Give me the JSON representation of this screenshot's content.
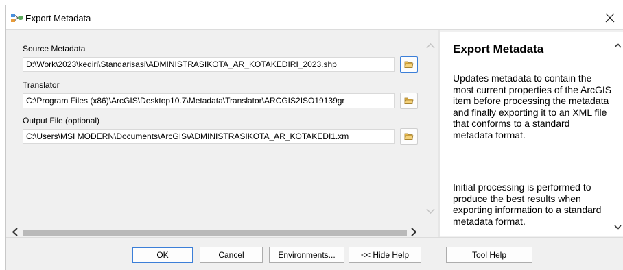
{
  "window": {
    "title": "Export Metadata",
    "close_symbol": "✕"
  },
  "params": [
    {
      "label": "Source Metadata",
      "value": "D:\\Work\\2023\\kediri\\Standarisasi\\ADMINISTRASIKOTA_AR_KOTAKEDIRI_2023.shp"
    },
    {
      "label": "Translator",
      "value": "C:\\Program Files (x86)\\ArcGIS\\Desktop10.7\\Metadata\\Translator\\ARCGIS2ISO19139gr"
    },
    {
      "label": "Output File (optional)",
      "value": "C:\\Users\\MSI MODERN\\Documents\\ArcGIS\\ADMINISTRASIKOTA_AR_KOTAKEDI1.xm"
    }
  ],
  "help": {
    "title": "Export Metadata",
    "paragraphs": [
      "Updates metadata to contain the most current properties of the ArcGIS item before processing the metadata and finally exporting it to an XML file that conforms to a standard metadata format.",
      "Initial processing is performed to produce the best results when exporting information to a standard metadata format."
    ]
  },
  "buttons": {
    "ok": "OK",
    "cancel": "Cancel",
    "environments": "Environments...",
    "hide_help": "<< Hide Help",
    "tool_help": "Tool Help"
  },
  "colors": {
    "accent": "#3c7fd8",
    "folder": "#e8b84a"
  }
}
